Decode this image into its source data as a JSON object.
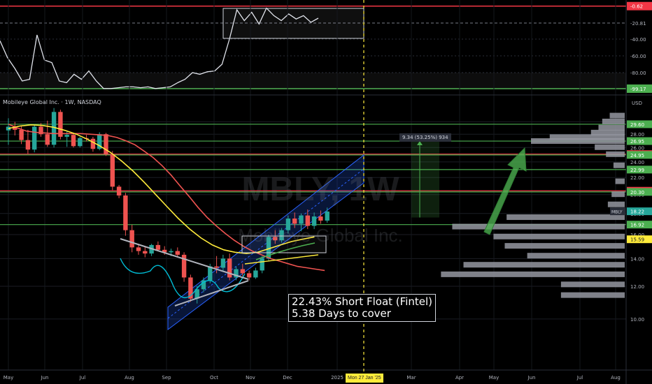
{
  "chart_title": "Mobileye Global Inc. · 1W, NASDAQ",
  "watermark": {
    "symbol": "MBLY, 1W",
    "name": "Mobileye Global Inc."
  },
  "annotation": {
    "line1": "22.43% Short Float (Fintel)",
    "line2": "5.38 Days to cover"
  },
  "measure_label": "9.34 (53.25%) 934",
  "currency_label": "USD",
  "cursor_date": "Mon 27 Jan '25",
  "colors": {
    "up": "#26a69a",
    "down": "#ef5350",
    "level_green": "#4caf50",
    "level_red": "#f23645",
    "sma_fast": "#ef5350",
    "sma_slow": "#ffeb3b",
    "channel": "#2962ff",
    "cursor": "#ffeb3b"
  },
  "chart_data": [
    {
      "type": "candlestick",
      "title": "Mobileye Global Inc. · 1W, NASDAQ",
      "ylabel": "USD",
      "y_scale": "log",
      "ylim": [
        9.5,
        33
      ],
      "x_tick_labels": [
        "May",
        "Jun",
        "Jul",
        "Aug",
        "Sep",
        "Oct",
        "Nov",
        "Dec",
        "2025",
        "Mar",
        "Apr",
        "May",
        "Jun",
        "Jul",
        "Aug"
      ],
      "y_tick_labels": [
        "10.00",
        "12.00",
        "14.00",
        "16.00",
        "18.00",
        "20.00",
        "22.00",
        "24.00",
        "26.00",
        "28.00",
        "30.00"
      ],
      "candles": [
        {
          "o": 28.6,
          "h": 30.6,
          "l": 26.4,
          "c": 29.2
        },
        {
          "o": 29.2,
          "h": 30.0,
          "l": 27.8,
          "c": 28.7
        },
        {
          "o": 28.7,
          "h": 29.4,
          "l": 26.5,
          "c": 27.1
        },
        {
          "o": 27.1,
          "h": 28.7,
          "l": 25.1,
          "c": 25.7
        },
        {
          "o": 25.7,
          "h": 29.6,
          "l": 25.3,
          "c": 29.2
        },
        {
          "o": 29.2,
          "h": 29.8,
          "l": 27.6,
          "c": 28.0
        },
        {
          "o": 28.0,
          "h": 30.2,
          "l": 26.1,
          "c": 26.4
        },
        {
          "o": 26.4,
          "h": 32.4,
          "l": 26.0,
          "c": 31.7
        },
        {
          "o": 31.7,
          "h": 32.1,
          "l": 27.2,
          "c": 27.6
        },
        {
          "o": 27.6,
          "h": 28.4,
          "l": 26.1,
          "c": 27.9
        },
        {
          "o": 27.9,
          "h": 28.2,
          "l": 26.0,
          "c": 26.2
        },
        {
          "o": 26.2,
          "h": 27.6,
          "l": 26.0,
          "c": 27.4
        },
        {
          "o": 27.4,
          "h": 27.9,
          "l": 26.9,
          "c": 27.3
        },
        {
          "o": 27.3,
          "h": 27.6,
          "l": 25.4,
          "c": 25.8
        },
        {
          "o": 25.8,
          "h": 28.3,
          "l": 25.6,
          "c": 28.0
        },
        {
          "o": 28.0,
          "h": 28.2,
          "l": 24.8,
          "c": 25.0
        },
        {
          "o": 25.0,
          "h": 25.5,
          "l": 20.5,
          "c": 20.9
        },
        {
          "o": 20.9,
          "h": 21.1,
          "l": 19.6,
          "c": 19.9
        },
        {
          "o": 19.9,
          "h": 20.2,
          "l": 15.9,
          "c": 16.4
        },
        {
          "o": 16.4,
          "h": 16.9,
          "l": 14.5,
          "c": 14.9
        },
        {
          "o": 14.9,
          "h": 15.2,
          "l": 14.3,
          "c": 14.6
        },
        {
          "o": 14.6,
          "h": 15.0,
          "l": 14.1,
          "c": 14.4
        },
        {
          "o": 14.4,
          "h": 15.2,
          "l": 14.2,
          "c": 15.1
        },
        {
          "o": 15.1,
          "h": 15.4,
          "l": 14.6,
          "c": 14.7
        },
        {
          "o": 14.7,
          "h": 15.0,
          "l": 14.3,
          "c": 14.5
        },
        {
          "o": 14.5,
          "h": 14.8,
          "l": 14.2,
          "c": 14.6
        },
        {
          "o": 14.6,
          "h": 14.9,
          "l": 14.1,
          "c": 14.3
        },
        {
          "o": 14.3,
          "h": 14.5,
          "l": 12.3,
          "c": 12.6
        },
        {
          "o": 12.6,
          "h": 12.8,
          "l": 11.0,
          "c": 11.2
        },
        {
          "o": 11.2,
          "h": 12.0,
          "l": 10.9,
          "c": 11.8
        },
        {
          "o": 11.8,
          "h": 12.6,
          "l": 11.6,
          "c": 12.4
        },
        {
          "o": 12.4,
          "h": 13.6,
          "l": 12.2,
          "c": 13.4
        },
        {
          "o": 13.4,
          "h": 14.2,
          "l": 12.9,
          "c": 13.3
        },
        {
          "o": 13.3,
          "h": 14.3,
          "l": 13.1,
          "c": 14.0
        },
        {
          "o": 14.0,
          "h": 14.4,
          "l": 12.4,
          "c": 12.6
        },
        {
          "o": 12.6,
          "h": 13.4,
          "l": 12.4,
          "c": 13.2
        },
        {
          "o": 13.2,
          "h": 13.6,
          "l": 12.7,
          "c": 12.9
        },
        {
          "o": 12.9,
          "h": 13.1,
          "l": 12.4,
          "c": 12.6
        },
        {
          "o": 12.6,
          "h": 13.3,
          "l": 12.5,
          "c": 13.1
        },
        {
          "o": 13.1,
          "h": 14.2,
          "l": 12.9,
          "c": 14.0
        },
        {
          "o": 14.0,
          "h": 16.0,
          "l": 13.8,
          "c": 15.8
        },
        {
          "o": 15.8,
          "h": 16.4,
          "l": 15.2,
          "c": 15.5
        },
        {
          "o": 15.5,
          "h": 16.6,
          "l": 15.3,
          "c": 16.4
        },
        {
          "o": 16.4,
          "h": 17.8,
          "l": 16.1,
          "c": 17.5
        },
        {
          "o": 17.5,
          "h": 18.1,
          "l": 16.6,
          "c": 17.0
        },
        {
          "o": 17.0,
          "h": 18.0,
          "l": 16.3,
          "c": 17.8
        },
        {
          "o": 17.8,
          "h": 18.4,
          "l": 16.5,
          "c": 16.8
        },
        {
          "o": 16.8,
          "h": 18.1,
          "l": 16.5,
          "c": 17.7
        },
        {
          "o": 17.7,
          "h": 18.3,
          "l": 17.0,
          "c": 17.3
        },
        {
          "o": 17.3,
          "h": 18.6,
          "l": 17.1,
          "c": 18.2
        }
      ],
      "sma_fast": [
        29.6,
        29.0,
        28.5,
        28.3,
        28.2,
        28.1,
        28.1,
        28.1,
        28.1,
        28.0,
        27.9,
        27.8,
        27.5,
        27.0,
        26.4,
        25.5,
        24.6,
        23.5,
        22.3,
        21.0,
        19.8,
        18.6,
        17.6,
        16.8,
        16.1,
        15.5,
        15.0,
        14.6,
        14.3,
        14.0,
        13.8,
        13.6,
        13.4,
        13.3,
        13.2,
        13.1
      ],
      "sma_fast_start_index": 0,
      "sma_slow": [
        28.9,
        29.3,
        29.5,
        29.4,
        29.1,
        28.6,
        28.0,
        27.2,
        26.3,
        25.3,
        24.1,
        22.8,
        21.4,
        20.0,
        18.7,
        17.5,
        16.5,
        15.7,
        15.1,
        14.7,
        14.5,
        14.4,
        14.5,
        14.8,
        15.1,
        15.4,
        15.6,
        15.8
      ],
      "sma_slow_anchor_indices": [
        0,
        2,
        4,
        6,
        8,
        10,
        12,
        14,
        16,
        18,
        20,
        22,
        24,
        26,
        28,
        30,
        32,
        34,
        36,
        38,
        40,
        42,
        44,
        46,
        48,
        50,
        52,
        54
      ],
      "horizontal_levels": [
        {
          "value": 29.6,
          "label": "29.60",
          "color": "green"
        },
        {
          "value": 26.95,
          "label": "26.95",
          "color": "green"
        },
        {
          "value": 25.06,
          "label": "25.06",
          "color": "red"
        },
        {
          "value": 24.95,
          "label": "24.95",
          "color": "green"
        },
        {
          "value": 22.99,
          "label": "22.99",
          "color": "green"
        },
        {
          "value": 20.43,
          "label": "20.43",
          "color": "red"
        },
        {
          "value": 20.3,
          "label": "20.30",
          "color": "green"
        },
        {
          "value": 16.92,
          "label": "16.92",
          "color": "green"
        }
      ],
      "price_tags": [
        {
          "value": 18.22,
          "label": "18.22",
          "sublabel": "MBLY"
        },
        {
          "value": 15.59,
          "label": "15.59"
        }
      ],
      "volume_profile": [
        {
          "price": 31.0,
          "width": 0.08
        },
        {
          "price": 30.0,
          "width": 0.12
        },
        {
          "price": 29.0,
          "width": 0.14
        },
        {
          "price": 28.2,
          "width": 0.18
        },
        {
          "price": 27.5,
          "width": 0.4
        },
        {
          "price": 26.9,
          "width": 0.5
        },
        {
          "price": 26.0,
          "width": 0.16
        },
        {
          "price": 25.0,
          "width": 0.1
        },
        {
          "price": 23.5,
          "width": 0.06
        },
        {
          "price": 21.5,
          "width": 0.05
        },
        {
          "price": 20.0,
          "width": 0.07
        },
        {
          "price": 18.9,
          "width": 0.09
        },
        {
          "price": 17.6,
          "width": 0.63
        },
        {
          "price": 16.7,
          "width": 0.92
        },
        {
          "price": 15.8,
          "width": 0.7
        },
        {
          "price": 15.0,
          "width": 0.64
        },
        {
          "price": 14.2,
          "width": 0.52
        },
        {
          "price": 13.5,
          "width": 0.86
        },
        {
          "price": 12.8,
          "width": 0.98
        },
        {
          "price": 12.1,
          "width": 0.34
        },
        {
          "price": 11.4,
          "width": 0.34
        }
      ],
      "projection_target": 26.95,
      "projection_base": 17.6
    },
    {
      "type": "line",
      "title": "",
      "ylim": [
        -100,
        0
      ],
      "y_tick_labels": [
        "-0.62",
        "-20.81",
        "-40.00",
        "-60.00",
        "-80.00",
        "-99.17"
      ],
      "reference_levels": [
        -0.62,
        -20.81,
        -99.17
      ],
      "values": [
        -42,
        -62,
        -75,
        -90,
        -88,
        -35,
        -65,
        -68,
        -90,
        -92,
        -82,
        -88,
        -78,
        -90,
        -99,
        -99,
        -98,
        -97,
        -97,
        -98,
        -97,
        -99,
        -98,
        -97,
        -92,
        -88,
        -80,
        -82,
        -79,
        -78,
        -70,
        -40,
        -5,
        -18,
        -8,
        -22,
        -3,
        -12,
        -18,
        -10,
        -16,
        -12,
        -20,
        -15
      ]
    }
  ]
}
